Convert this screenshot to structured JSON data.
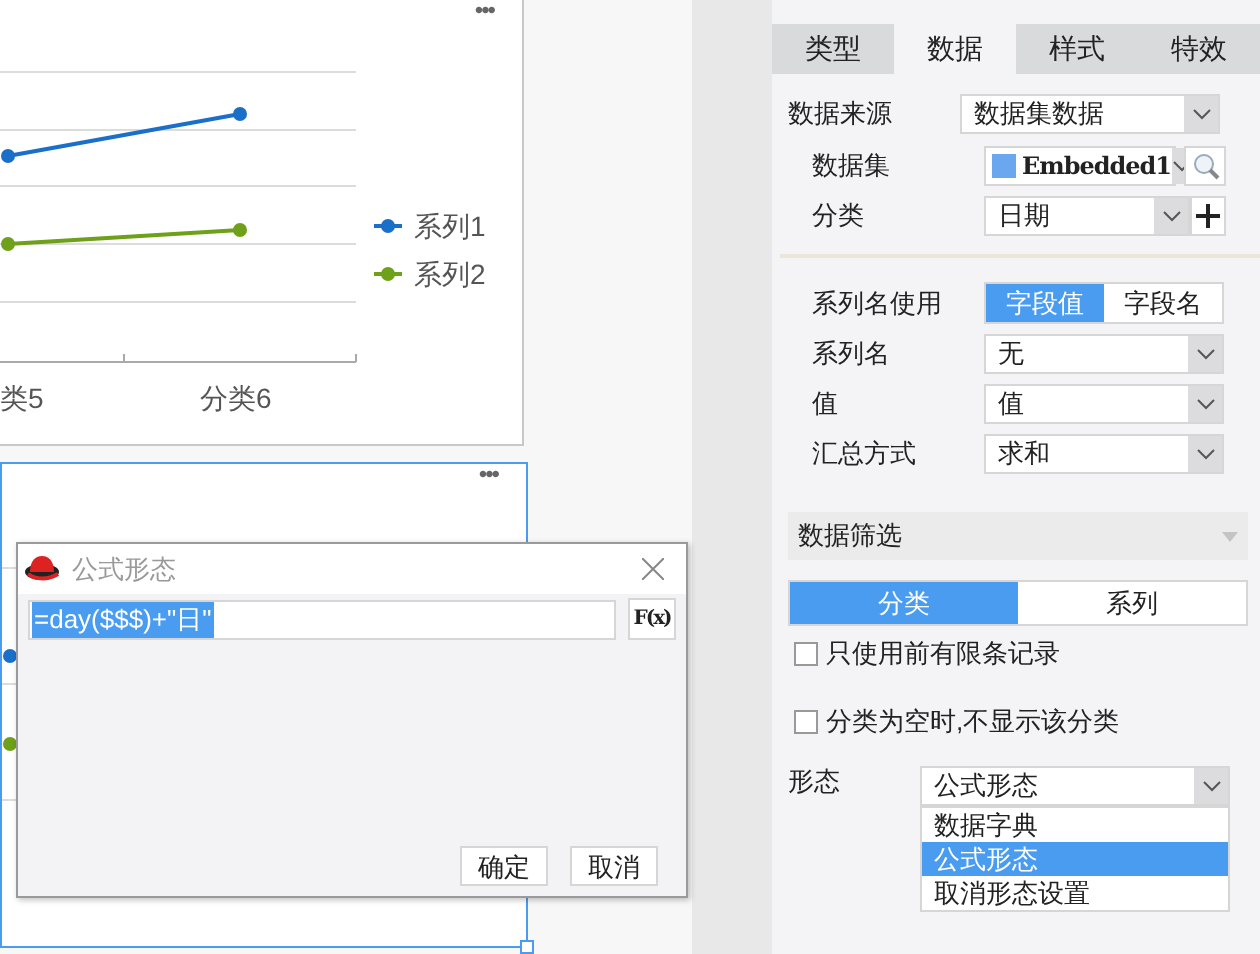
{
  "charts": [
    {
      "more": "•••",
      "selected": false,
      "categories": [
        "类5",
        "分类6"
      ],
      "legend": [
        {
          "name": "系列1",
          "color": "#1a6fc9"
        },
        {
          "name": "系列2",
          "color": "#6ea01a"
        }
      ]
    },
    {
      "more": "•••",
      "selected": true
    }
  ],
  "dialog": {
    "title": "公式形态",
    "formula": "=day($$$)+\"日\"",
    "formula_selected": true,
    "fx_button": "F(x)",
    "buttons": [
      "确定",
      "取消"
    ]
  },
  "panel": {
    "tabs": [
      {
        "label": "类型",
        "selected": false
      },
      {
        "label": "数据",
        "selected": true
      },
      {
        "label": "样式",
        "selected": false
      },
      {
        "label": "特效",
        "selected": false
      }
    ],
    "source": {
      "label": "数据来源",
      "value": "数据集数据"
    },
    "dataset": {
      "label": "数据集",
      "value": "Embedded1"
    },
    "category": {
      "label": "分类",
      "value": "日期"
    },
    "series_name_use": {
      "label": "系列名使用",
      "options": [
        {
          "label": "字段值",
          "selected": true
        },
        {
          "label": "字段名",
          "selected": false
        }
      ]
    },
    "fields": [
      {
        "label": "系列名",
        "value": "无"
      },
      {
        "label": "值",
        "value": "值"
      },
      {
        "label": "汇总方式",
        "value": "求和"
      }
    ],
    "filter": {
      "title": "数据筛选",
      "tabs": [
        {
          "label": "分类",
          "selected": true
        },
        {
          "label": "系列",
          "selected": false
        }
      ],
      "checks": [
        {
          "label": "只使用前有限条记录",
          "checked": false
        },
        {
          "label": "分类为空时,不显示该分类",
          "checked": false
        }
      ]
    },
    "form": {
      "label": "形态",
      "value": "公式形态",
      "expanded": true,
      "options": [
        {
          "label": "数据字典",
          "selected": false
        },
        {
          "label": "公式形态",
          "selected": true
        },
        {
          "label": "取消形态设置",
          "selected": false
        }
      ]
    }
  }
}
